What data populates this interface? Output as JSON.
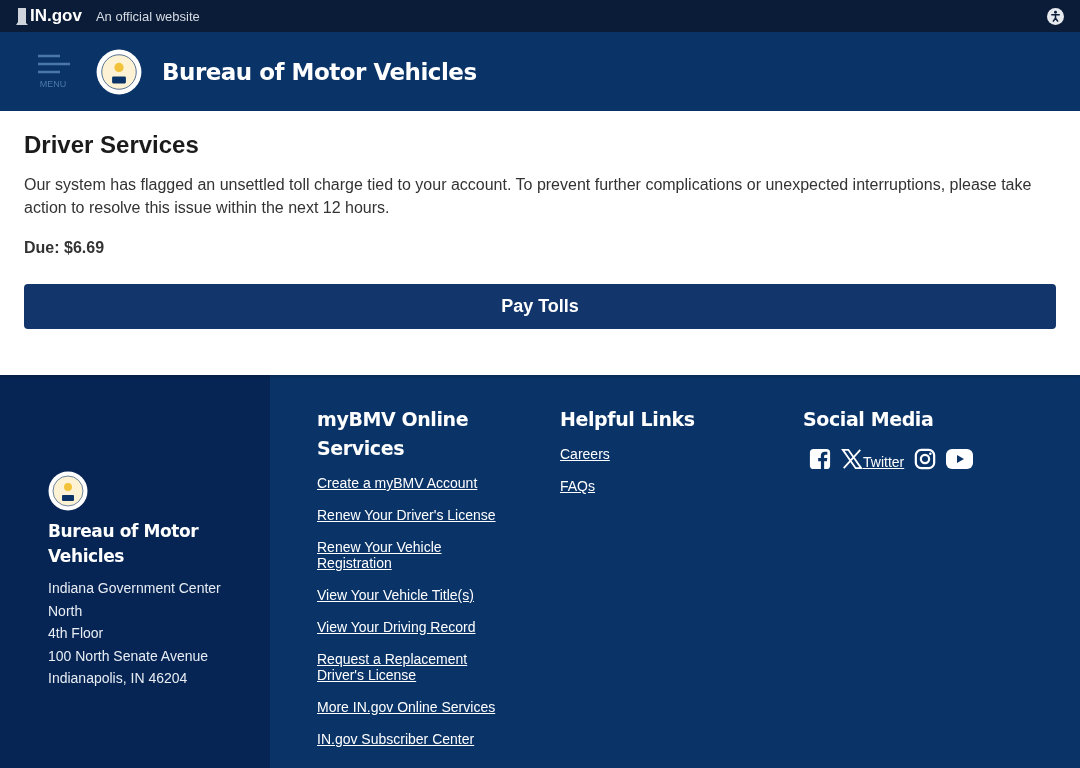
{
  "top_bar": {
    "logo": "IN.gov",
    "tagline": "An official website"
  },
  "header": {
    "menu_label": "MENU",
    "title": "Bureau of Motor Vehicles"
  },
  "main": {
    "heading": "Driver Services",
    "message": "Our system has flagged an unsettled toll charge tied to your account. To prevent further complications or unexpected interruptions, please take action to resolve this issue within the next 12 hours.",
    "due": "Due: $6.69",
    "button": "Pay Tolls"
  },
  "footer": {
    "agency": {
      "name": "Bureau of Motor Vehicles",
      "address": [
        "Indiana Government Center North",
        "4th Floor",
        "100 North Senate Avenue",
        "Indianapolis, IN 46204"
      ]
    },
    "columns": [
      {
        "title": "myBMV Online Services",
        "links": [
          "Create a myBMV Account",
          "Renew Your Driver's License",
          "Renew Your Vehicle Registration",
          "View Your Vehicle Title(s)",
          "View Your Driving Record",
          "Request a Replacement Driver's License",
          "More IN.gov Online Services",
          "IN.gov Subscriber Center"
        ]
      },
      {
        "title": "Helpful Links",
        "links": [
          "Careers",
          "FAQs"
        ]
      }
    ],
    "social": {
      "title": "Social Media",
      "items": [
        {
          "kind": "facebook"
        },
        {
          "kind": "x",
          "label": "Twitter"
        },
        {
          "kind": "instagram"
        },
        {
          "kind": "youtube"
        }
      ]
    }
  }
}
